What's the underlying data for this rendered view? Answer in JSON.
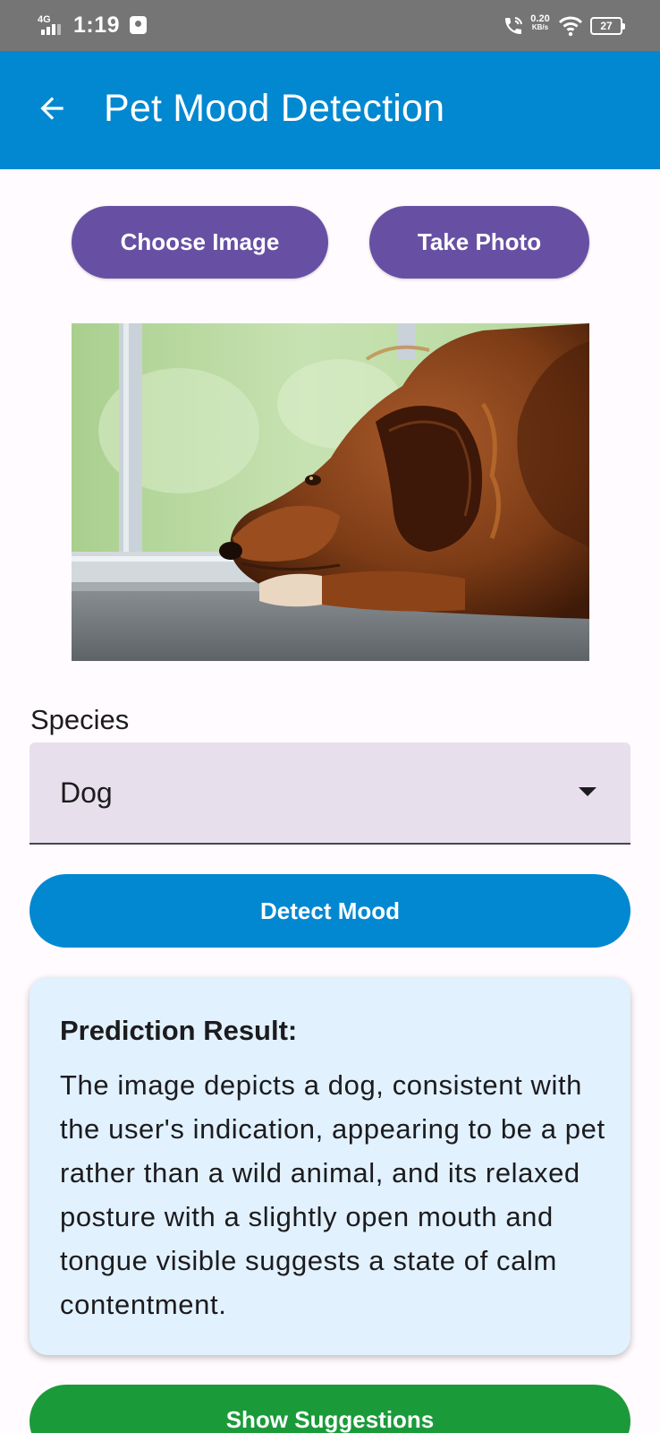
{
  "status_bar": {
    "network": "4G",
    "time": "1:19",
    "speed_value": "0.20",
    "speed_unit": "KB/s",
    "battery": "27"
  },
  "app_bar": {
    "title": "Pet Mood Detection",
    "back_icon": "arrow-left-icon"
  },
  "actions": {
    "choose_image": "Choose Image",
    "take_photo": "Take Photo"
  },
  "photo": {
    "subject": "dog-photo"
  },
  "species": {
    "label": "Species",
    "selected": "Dog"
  },
  "detect": {
    "label": "Detect Mood"
  },
  "result": {
    "title": "Prediction Result:",
    "text": "The image depicts a dog, consistent with the user's indication, appearing to be a pet rather than a wild animal, and its relaxed posture with a slightly open mouth and tongue visible suggests a state of calm contentment."
  },
  "suggestions": {
    "label": "Show Suggestions"
  },
  "colors": {
    "app_bar": "#0288d1",
    "primary_button": "#6750a4",
    "select_bg": "#e7e0ec",
    "result_bg": "#e1f1fd",
    "suggest_button": "#1b9a3a"
  }
}
